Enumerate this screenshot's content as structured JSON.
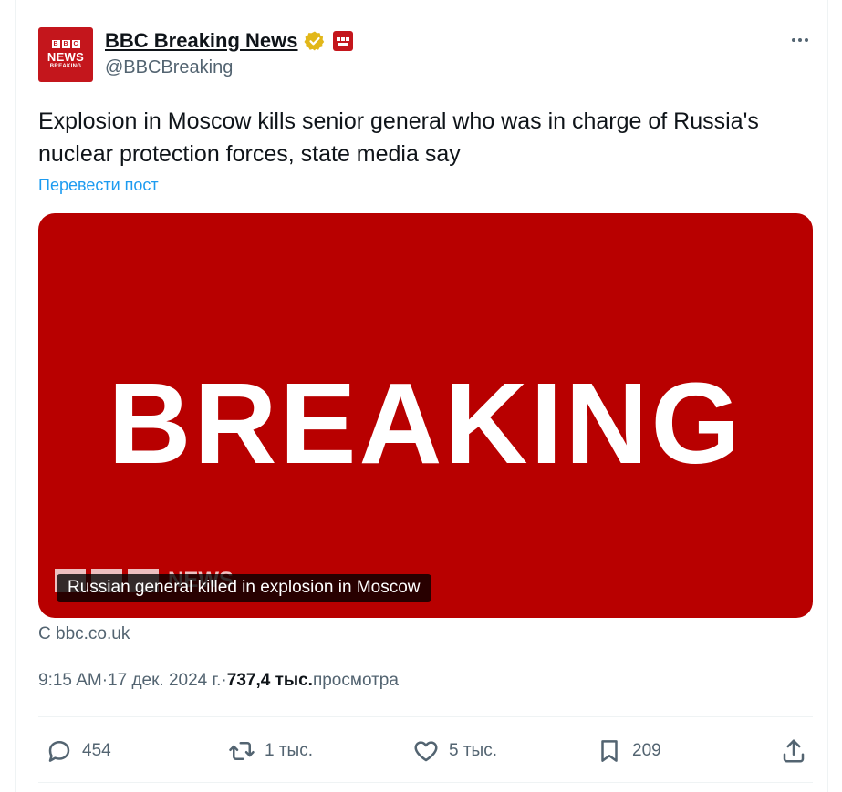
{
  "author": {
    "avatar_lines": [
      "B",
      "B",
      "C",
      "NEWS",
      "BREAKING"
    ],
    "display_name": "BBC Breaking News",
    "handle": "@BBCBreaking",
    "verified_color": "#e2b719",
    "brand_red": "#c4161c"
  },
  "tweet": {
    "text": "Explosion in Moscow kills senior general who was in charge of Russia's nuclear protection forces, state media say",
    "translate_label": "Перевести пост"
  },
  "media": {
    "headline_word": "BREAKING",
    "watermark": "NEWS",
    "caption": "Russian general killed in explosion in Moscow",
    "background_color": "#b80000"
  },
  "source": "С bbc.co.uk",
  "meta": {
    "time": "9:15 AM",
    "separator": " · ",
    "date": "17 дек. 2024 г.",
    "views_count": "737,4 тыс.",
    "views_label": " просмотра"
  },
  "actions": {
    "reply_count": "454",
    "repost_count": "1 тыс.",
    "like_count": "5 тыс.",
    "bookmark_count": "209"
  },
  "colors": {
    "text_primary": "#0f1419",
    "text_secondary": "#536471",
    "link": "#1d9bf0"
  }
}
